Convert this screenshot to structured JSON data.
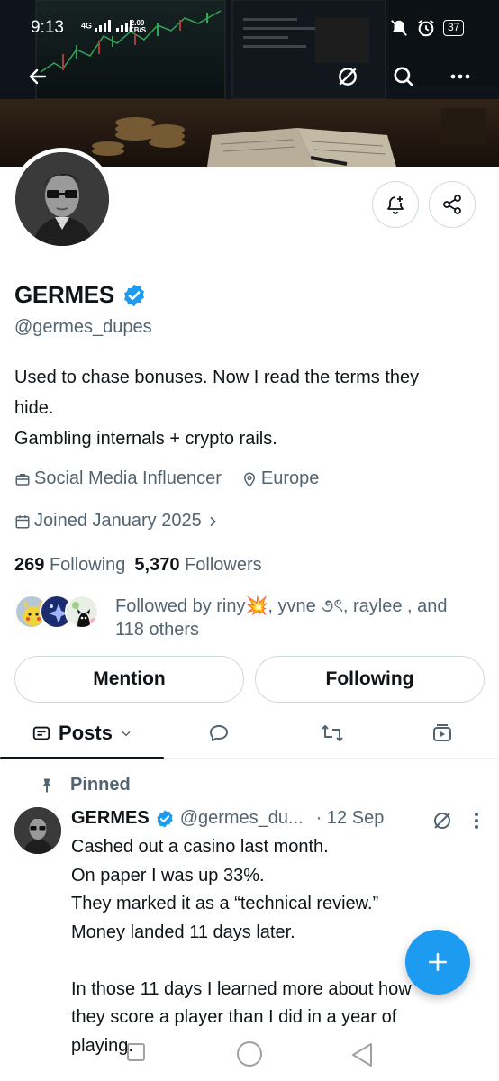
{
  "status_bar": {
    "time": "9:13",
    "network": "4G",
    "speed_value": "2.00",
    "speed_unit": "KB/S",
    "battery": "37"
  },
  "header": {
    "back_icon": "arrow-left-icon",
    "grok_icon": "grok-icon",
    "search_icon": "search-icon",
    "more_icon": "more-horizontal-icon"
  },
  "profile": {
    "name": "GERMES",
    "verified": true,
    "handle": "@germes_dupes",
    "bio_lines": [
      "Used to chase bonuses. Now I read the terms they",
      "hide.",
      "Gambling internals + crypto rails."
    ],
    "category": "Social Media Influencer",
    "location": "Europe",
    "joined": "Joined January 2025",
    "following_count": "269",
    "following_label": "Following",
    "followers_count": "5,370",
    "followers_label": "Followers",
    "followed_by_line1": "Followed by riny💥, yvne ૭ৎ, raylee    , and",
    "followed_by_line2": "118 others"
  },
  "actions": {
    "notify_icon": "bell-plus-icon",
    "share_icon": "share-icon",
    "mention_label": "Mention",
    "following_label": "Following"
  },
  "tabs": {
    "posts_label": "Posts",
    "items": [
      "posts",
      "replies",
      "reposts",
      "media"
    ]
  },
  "pinned_post": {
    "pinned_label": "Pinned",
    "author_name": "GERMES",
    "author_handle": "@germes_du...",
    "date": "· 12 Sep",
    "body": [
      "Cashed out a casino last month.",
      "On paper I was up 33%.",
      "They marked it as a “technical review.”",
      "Money landed 11 days later.",
      "",
      "In those 11 days I learned more about how",
      "they score a player than I did in a year of",
      "playing."
    ]
  },
  "colors": {
    "accent": "#1d9bf0",
    "text_primary": "#0f1419",
    "text_secondary": "#536471",
    "border": "#cfd9de"
  }
}
